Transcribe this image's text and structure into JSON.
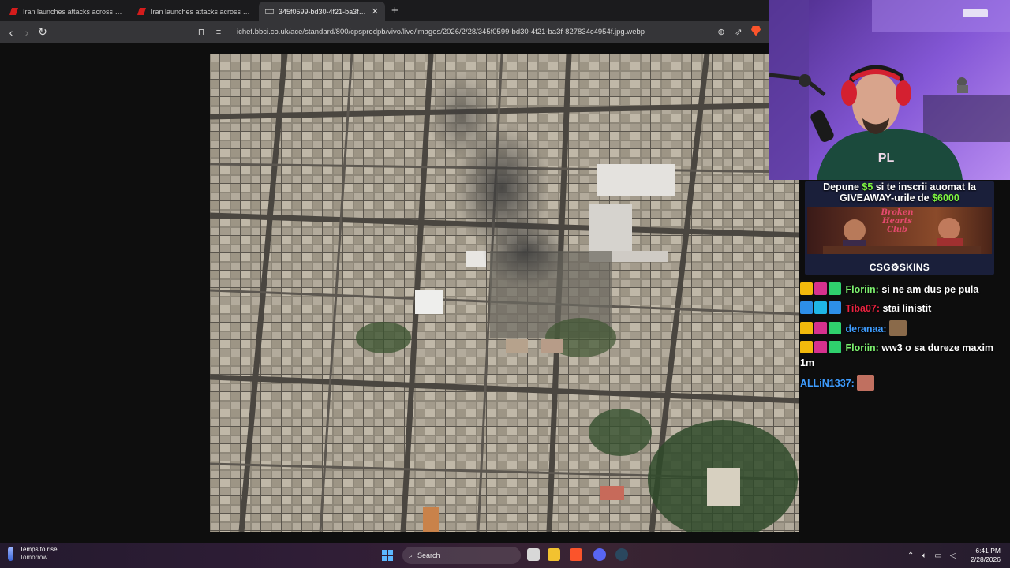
{
  "browser": {
    "tabs": [
      {
        "title": "Iran launches attacks across Middle East",
        "active": false,
        "favicon": "bbc-red-icon"
      },
      {
        "title": "Iran launches attacks across Middle East",
        "active": false,
        "favicon": "bbc-red-icon"
      },
      {
        "title": "345f0599-bd30-4f21-ba3f-827834c4954f.jpg.webp",
        "active": true,
        "favicon": "image-icon"
      }
    ],
    "new_tab": "+",
    "address": "ichef.bbci.co.uk/ace/standard/800/cpsprodpb/vivo/live/images/2026/2/28/345f0599-bd30-4f21-ba3f-827834c4954f.jpg.webp"
  },
  "stream": {
    "ad": {
      "line1_pre": "Depune ",
      "line1_money": "$5",
      "line1_post": " si te inscrii auomat la",
      "line2_pre": "GIVEAWAY-urile de ",
      "line2_money": "$6000",
      "banner_title": "Broken Hearts Club",
      "brand": "CSG⚙SKINS"
    },
    "chat": [
      {
        "user": "Floriin:",
        "text": " si ne am dus pe pula",
        "color": "#7cf06e"
      },
      {
        "user": "Tiba07:",
        "text": " stai linistit",
        "color": "#ea2340"
      },
      {
        "user": "deranaa:",
        "text": "",
        "color": "#3f9dff"
      },
      {
        "user": "Floriin:",
        "text": " ww3 o sa dureze maxim 1m",
        "color": "#7cf06e"
      },
      {
        "user": "ALLiN1337:",
        "text": "",
        "color": "#3f9dff"
      }
    ]
  },
  "taskbar": {
    "weather_title": "Temps to rise",
    "weather_sub": "Tomorrow",
    "search": "Search",
    "time": "6:41 PM",
    "date": "2/28/2026"
  }
}
